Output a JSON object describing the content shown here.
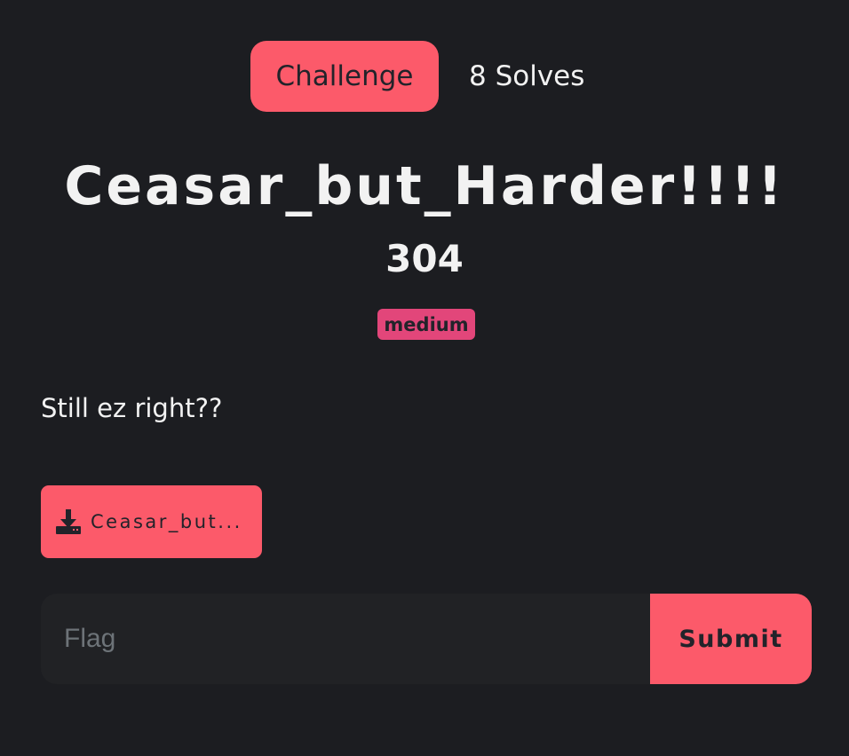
{
  "tabs": {
    "challenge_label": "Challenge",
    "solves_label": "8 Solves"
  },
  "challenge": {
    "name": "Ceasar_but_Harder!!!!",
    "points": "304",
    "difficulty": "medium",
    "description": "Still ez right??"
  },
  "files": [
    {
      "label": "Ceasar_but...",
      "icon": "download-icon"
    }
  ],
  "flag_form": {
    "placeholder": "Flag",
    "value": "",
    "submit_label": "Submit"
  },
  "colors": {
    "background": "#1c1d21",
    "accent": "#fc5a6a",
    "badge": "#e2467a",
    "input_background": "#212225",
    "text": "#f2f2f2",
    "dark_text": "#22232a"
  }
}
